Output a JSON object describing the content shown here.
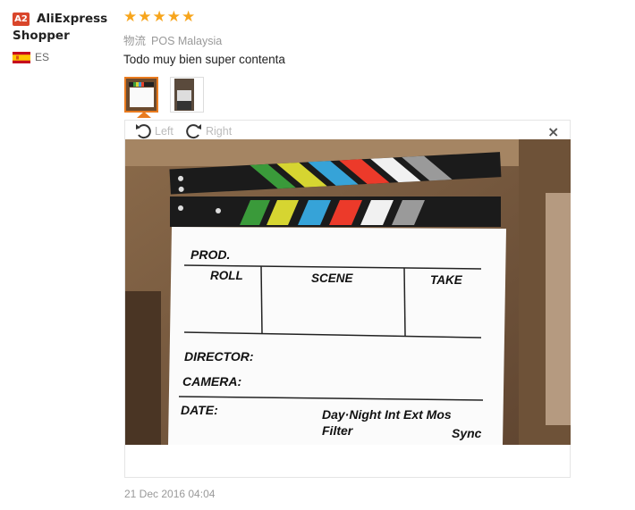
{
  "user": {
    "badge": "A2",
    "name": "AliExpress Shopper",
    "country_code": "ES",
    "flag_icon": "spain-flag-icon"
  },
  "review": {
    "stars": 5,
    "star_color": "#f7a51c",
    "logistics_label": "物流",
    "logistics_value": "POS Malaysia",
    "text": "Todo muy bien super contenta",
    "date": "21 Dec 2016 04:04"
  },
  "viewer": {
    "rotate_left_label": "Left",
    "rotate_right_label": "Right",
    "close_symbol": "×",
    "thumbnails": [
      "clapperboard-photo",
      "clapperboard-photo-2"
    ],
    "selected_thumbnail": 0,
    "accent": "#e97b1f"
  },
  "clapperboard": {
    "row1_label": "PROD.",
    "roll_label": "ROLL",
    "scene_label": "SCENE",
    "take_label": "TAKE",
    "director_label": "DIRECTOR:",
    "camera_label": "CAMERA:",
    "date_label": "DATE:",
    "options_line1": "Day·Night Int Ext Mos",
    "options_line2_left": "Filter",
    "options_line2_right": "Sync"
  }
}
